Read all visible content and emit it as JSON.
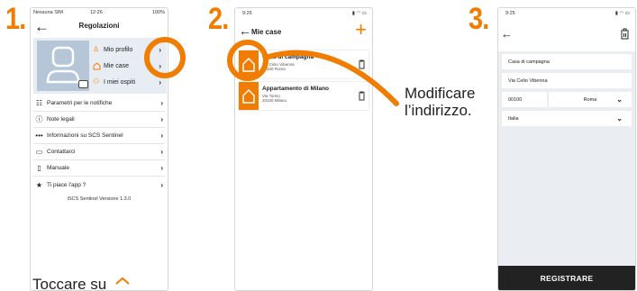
{
  "steps": [
    "1.",
    "2.",
    "3."
  ],
  "colors": {
    "accent": "#f07d00",
    "avatar_bg": "#b4c6d8",
    "submit_bg": "#222222",
    "page_bg": "#eaeef3"
  },
  "screen1": {
    "status_carrier": "Nessuna SIM",
    "status_time": "12:26",
    "status_battery": "100%",
    "title": "Regolazioni",
    "profile_menu": [
      {
        "icon": "person-icon",
        "label": "Mio profilo"
      },
      {
        "icon": "house-icon",
        "label": "Mie case"
      },
      {
        "icon": "guests-icon",
        "label": "I miei ospiti"
      }
    ],
    "rows": [
      {
        "icon": "sliders-icon",
        "label": "Parametri per le notifiche"
      },
      {
        "icon": "info-icon",
        "label": "Note legali"
      },
      {
        "icon": "dots-icon",
        "label": "Informazioni su SCS Sentinel"
      },
      {
        "icon": "chat-icon",
        "label": "Contattarci"
      },
      {
        "icon": "document-icon",
        "label": "Manuale"
      },
      {
        "icon": "star-icon",
        "label": "Ti piace l'app ?"
      }
    ],
    "version": "iSCS Sentinel Versione 1.3.0"
  },
  "screen2": {
    "status_time": "9:25",
    "title": "Mie case",
    "houses": [
      {
        "name": "Casa di campagna",
        "line1": "Via Celio Vibenna",
        "line2": "00100 Roma"
      },
      {
        "name": "Appartamento di Milano",
        "line1": "Via Torino",
        "line2": "20100 Milano"
      }
    ]
  },
  "callout": {
    "line1": "Modificare",
    "line2": "l’indirizzo."
  },
  "screen3": {
    "status_time": "9:25",
    "name_value": "Casa di campagna",
    "street_value": "Via Celio Vibenna",
    "zip_value": "00100",
    "city_value": "Roma",
    "country_value": "Italia",
    "submit_label": "REGISTRARE"
  },
  "bottom_caption": "Toccare su"
}
